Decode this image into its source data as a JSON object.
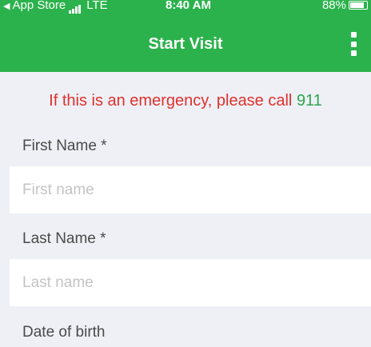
{
  "status_bar": {
    "back_app": "App Store",
    "network": "LTE",
    "time": "8:40 AM",
    "battery": "88%"
  },
  "header": {
    "title": "Start Visit",
    "menu_icon": "vertical-ellipsis-icon",
    "background_color": "#2bb24c"
  },
  "emergency": {
    "text": "If this is an emergency, please call ",
    "number": "911",
    "text_color": "#e0312c",
    "number_color": "#2ea44f"
  },
  "form": {
    "first_name": {
      "label": "First Name *",
      "placeholder": "First name",
      "value": ""
    },
    "last_name": {
      "label": "Last Name *",
      "placeholder": "Last name",
      "value": ""
    },
    "dob": {
      "label": "Date of birth"
    }
  }
}
